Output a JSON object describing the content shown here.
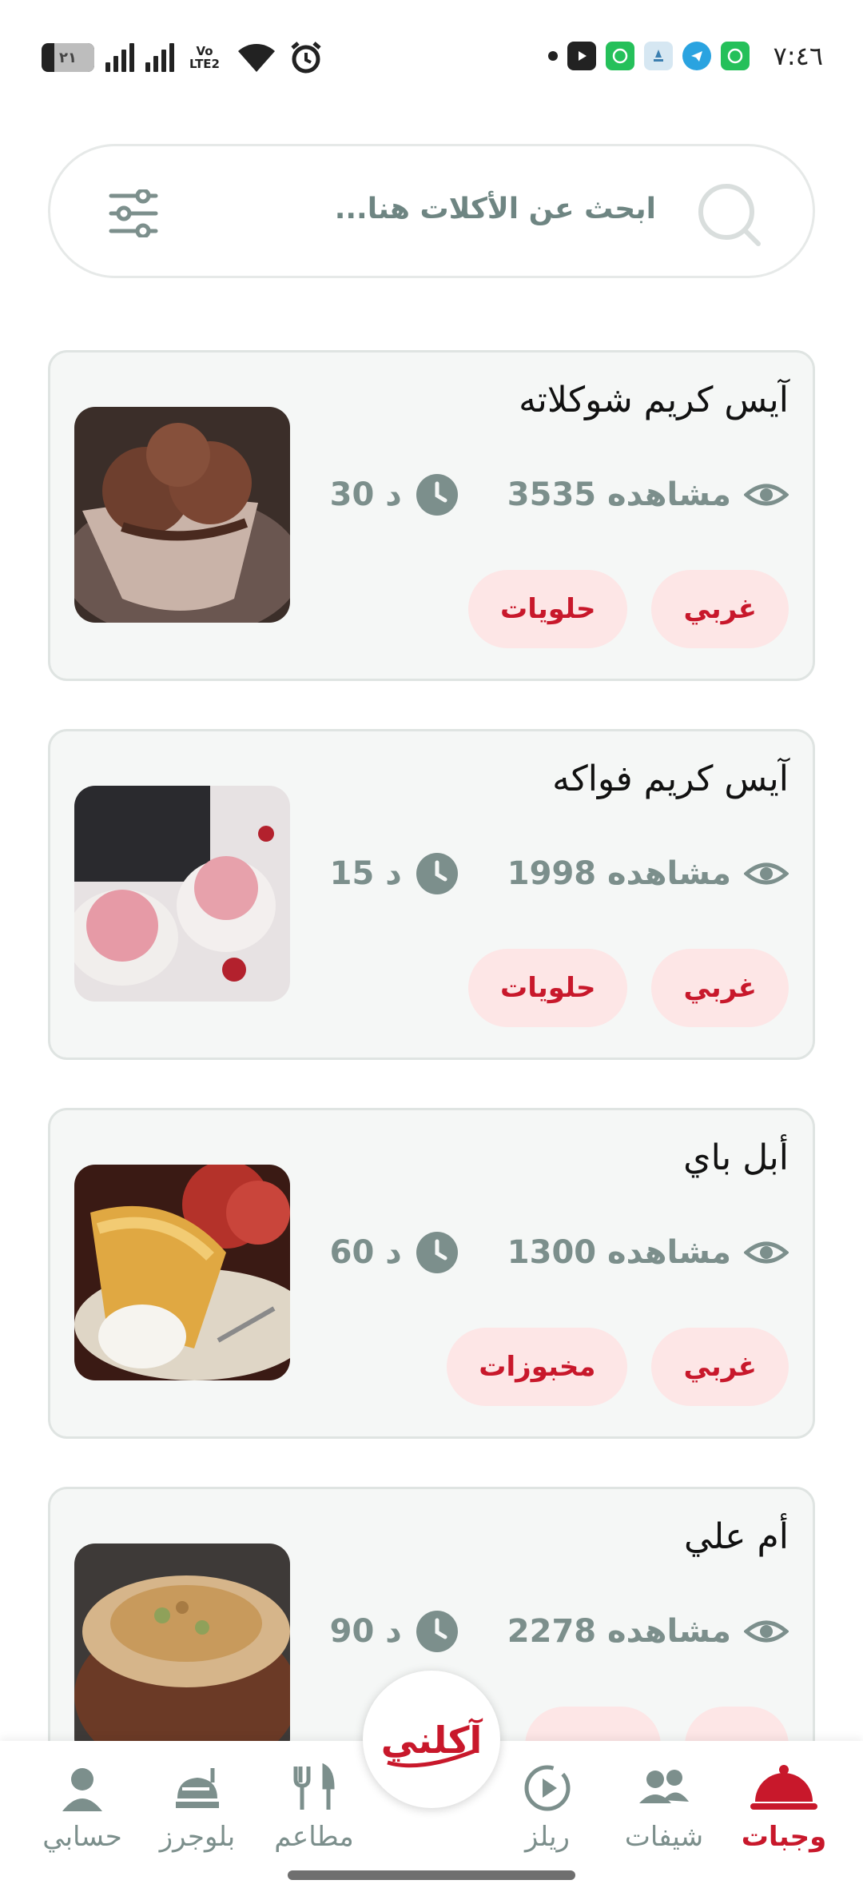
{
  "status_bar": {
    "time": "٧:٤٦",
    "battery": "٢١",
    "network": "Vo LTE2"
  },
  "search": {
    "placeholder": "ابحث عن الأكلات هنا..."
  },
  "recipes": [
    {
      "title": "آيس كريم شوكلاته",
      "views": "3535 مشاهده",
      "time": "30 د",
      "tags": [
        "غربي",
        "حلويات"
      ]
    },
    {
      "title": "آيس كريم فواكه",
      "views": "1998 مشاهده",
      "time": "15 د",
      "tags": [
        "غربي",
        "حلويات"
      ]
    },
    {
      "title": "أبل باي",
      "views": "1300 مشاهده",
      "time": "60 د",
      "tags": [
        "غربي",
        "مخبوزات"
      ]
    },
    {
      "title": "أم علي",
      "views": "2278 مشاهده",
      "time": "90 د",
      "tags": [
        "",
        ""
      ]
    }
  ],
  "nav": {
    "meals": "وجبات",
    "chefs": "شيفات",
    "reels": "ريلز",
    "restaurants": "مطاعم",
    "bloggers": "بلوجرز",
    "account": "حسابي",
    "logo_text": "آكلني"
  },
  "colors": {
    "accent": "#c8182b",
    "muted": "#7c8f8c",
    "tag_bg": "#fde6e6"
  }
}
